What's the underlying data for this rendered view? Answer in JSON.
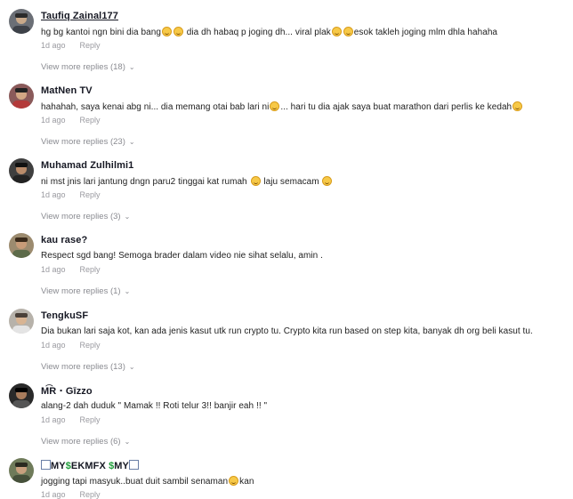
{
  "colors": {
    "muted": "#9a9aa0",
    "text": "#161823"
  },
  "comments": [
    {
      "username": "Taufiq Zainal177",
      "parts": [
        "hg bg kantoi ngn bini dia bang",
        " dia dh habaq p joging dh... viral plak",
        "esok takleh joging mlm dhla hahaha"
      ],
      "time": "1d ago",
      "reply": "Reply",
      "more": "View more replies (18)"
    },
    {
      "username": "MatNen TV",
      "parts": [
        "hahahah, saya kenai abg ni... dia memang otai bab lari ni",
        "... hari tu dia ajak saya buat marathon dari perlis ke kedah"
      ],
      "time": "1d ago",
      "reply": "Reply",
      "more": "View more replies (23)"
    },
    {
      "username": "Muhamad Zulhilmi1",
      "parts": [
        "ni mst jnis lari jantung dngn paru2 tinggai kat rumah ",
        " laju semacam "
      ],
      "time": "1d ago",
      "reply": "Reply",
      "more": "View more replies (3)"
    },
    {
      "username": "kau rase?",
      "parts": [
        "Respect sgd bang! Semoga brader dalam video nie sihat selalu, amin ."
      ],
      "time": "1d ago",
      "reply": "Reply",
      "more": "View more replies (1)"
    },
    {
      "username": "TengkuSF",
      "parts": [
        "Dia bukan lari saja kot, kan ada jenis kasut utk run crypto tu. Crypto kita run based on step kita, banyak dh org beli kasut tu."
      ],
      "time": "1d ago",
      "reply": "Reply",
      "more": "View more replies (13)"
    },
    {
      "username": "M͡R ⋅ Gīzzo",
      "parts": [
        "alang-2 dah duduk \" Mamak !! Roti telur 3!! banjir eah !! \""
      ],
      "time": "1d ago",
      "reply": "Reply",
      "more": "View more replies (6)"
    },
    {
      "username_parts": [
        "MY",
        "$",
        "EKMFX ",
        "$",
        "MY"
      ],
      "parts": [
        "jogging tapi masyuk..buat duit sambil senaman",
        "kan"
      ],
      "time": "1d ago",
      "reply": "Reply"
    }
  ]
}
